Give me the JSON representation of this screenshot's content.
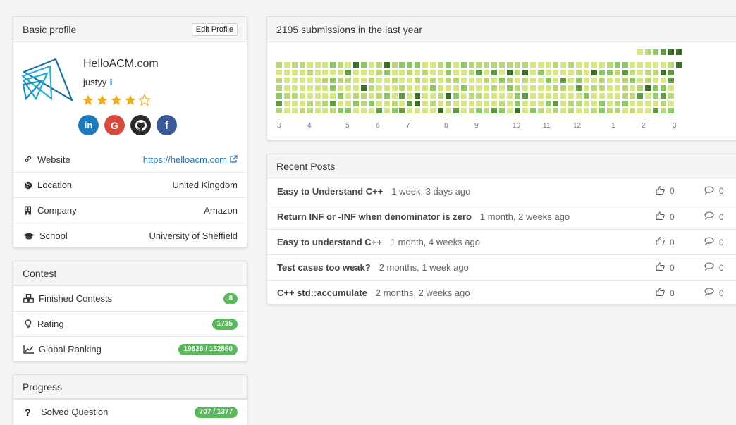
{
  "profile": {
    "header": "Basic profile",
    "edit_label": "Edit Profile",
    "name": "HelloACM.com",
    "username": "justyy",
    "rating_stars": 4,
    "rating_max": 5,
    "socials": [
      "linkedin",
      "google",
      "github",
      "facebook"
    ],
    "rows": [
      {
        "icon": "link-icon",
        "label": "Website",
        "value": "https://helloacm.com",
        "is_link": true
      },
      {
        "icon": "globe-icon",
        "label": "Location",
        "value": "United Kingdom"
      },
      {
        "icon": "building-icon",
        "label": "Company",
        "value": "Amazon"
      },
      {
        "icon": "graduation-cap-icon",
        "label": "School",
        "value": "University of Sheffield"
      }
    ]
  },
  "contest": {
    "header": "Contest",
    "rows": [
      {
        "icon": "cubes-icon",
        "label": "Finished Contests",
        "value": "8"
      },
      {
        "icon": "lightbulb-icon",
        "label": "Rating",
        "value": "1735"
      },
      {
        "icon": "line-chart-icon",
        "label": "Global Ranking",
        "value": "19828 / 152860"
      }
    ]
  },
  "progress": {
    "header": "Progress",
    "rows": [
      {
        "icon": "question-icon",
        "label": "Solved Question",
        "value": "707 / 1377"
      }
    ]
  },
  "submissions": {
    "header": "2195 submissions in the last year",
    "month_labels": [
      "3",
      "4",
      "5",
      "6",
      "7",
      "8",
      "9",
      "10",
      "11",
      "12",
      "1",
      "2",
      "3"
    ]
  },
  "recent_posts": {
    "header": "Recent Posts",
    "posts": [
      {
        "title": "Easy to Understand C++",
        "time": "1 week, 3 days ago",
        "likes": "0",
        "comments": "0"
      },
      {
        "title": "Return INF or -INF when denominator is zero",
        "time": "1 month, 2 weeks ago",
        "likes": "0",
        "comments": "0"
      },
      {
        "title": "Easy to understand C++",
        "time": "1 month, 4 weeks ago",
        "likes": "0",
        "comments": "0"
      },
      {
        "title": "Test cases too weak?",
        "time": "2 months, 1 week ago",
        "likes": "0",
        "comments": "0"
      },
      {
        "title": "C++ std::accumulate",
        "time": "2 months, 2 weeks ago",
        "likes": "0",
        "comments": "0"
      }
    ]
  },
  "colors": {
    "badge": "#5cb85c",
    "link": "#2a7ab8",
    "star": "#f0ad1a",
    "heat_levels": [
      "#d6e685",
      "#b9d67b",
      "#8cc665",
      "#5f9a45",
      "#3a6f2a"
    ]
  }
}
